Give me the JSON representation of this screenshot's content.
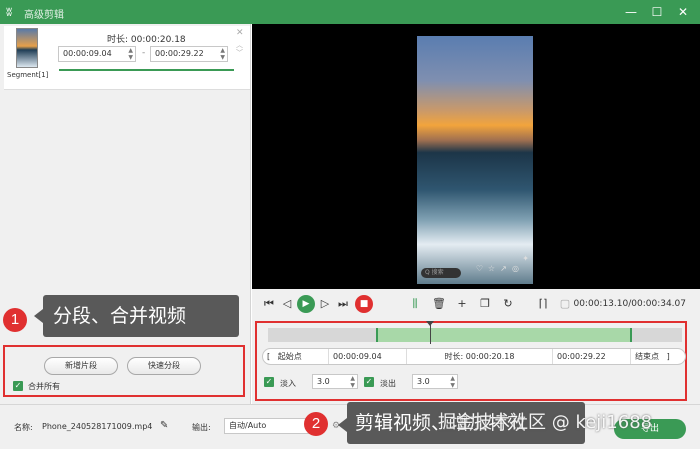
{
  "window": {
    "title": "高级剪辑",
    "controls": {
      "minimize": "—",
      "maximize": "☐",
      "close": "✕"
    }
  },
  "segment": {
    "label": "Segment[1]",
    "duration_label": "时长:",
    "duration_value": "00:00:20.18",
    "start": "00:00:09.04",
    "end": "00:00:29.22",
    "separator": "-"
  },
  "overlays": {
    "step1_num": "1",
    "step1_text": "分段、合并视频",
    "step2_num": "2",
    "step2_text": "剪辑视频、增加特效"
  },
  "left_actions": {
    "add_segment": "新增片段",
    "quick_split": "快速分段",
    "merge_all": "合并所有"
  },
  "video": {
    "search_hint": "Q 搜索"
  },
  "playback": {
    "time_current": "00:00:13.10",
    "time_total": "00:00:34.07",
    "time_sep": "/"
  },
  "range": {
    "start_point": "起始点",
    "start_time": "00:00:09.04",
    "duration_label": "时长:",
    "duration_value": "00:00:20.18",
    "end_time": "00:00:29.22",
    "end_point": "结束点"
  },
  "effects": {
    "fade_in_label": "淡入",
    "fade_in_value": "3.0",
    "fade_out_label": "淡出",
    "fade_out_value": "3.0"
  },
  "bottom": {
    "name_label": "名称:",
    "file_name": "Phone_240528171009.mp4",
    "output_label": "输出:",
    "output_value": "自动/Auto",
    "export_button": "导出"
  },
  "watermark": "掘金技术社区 @ keji1688",
  "colors": {
    "accent": "#3a9a55",
    "marker": "#e03030"
  }
}
